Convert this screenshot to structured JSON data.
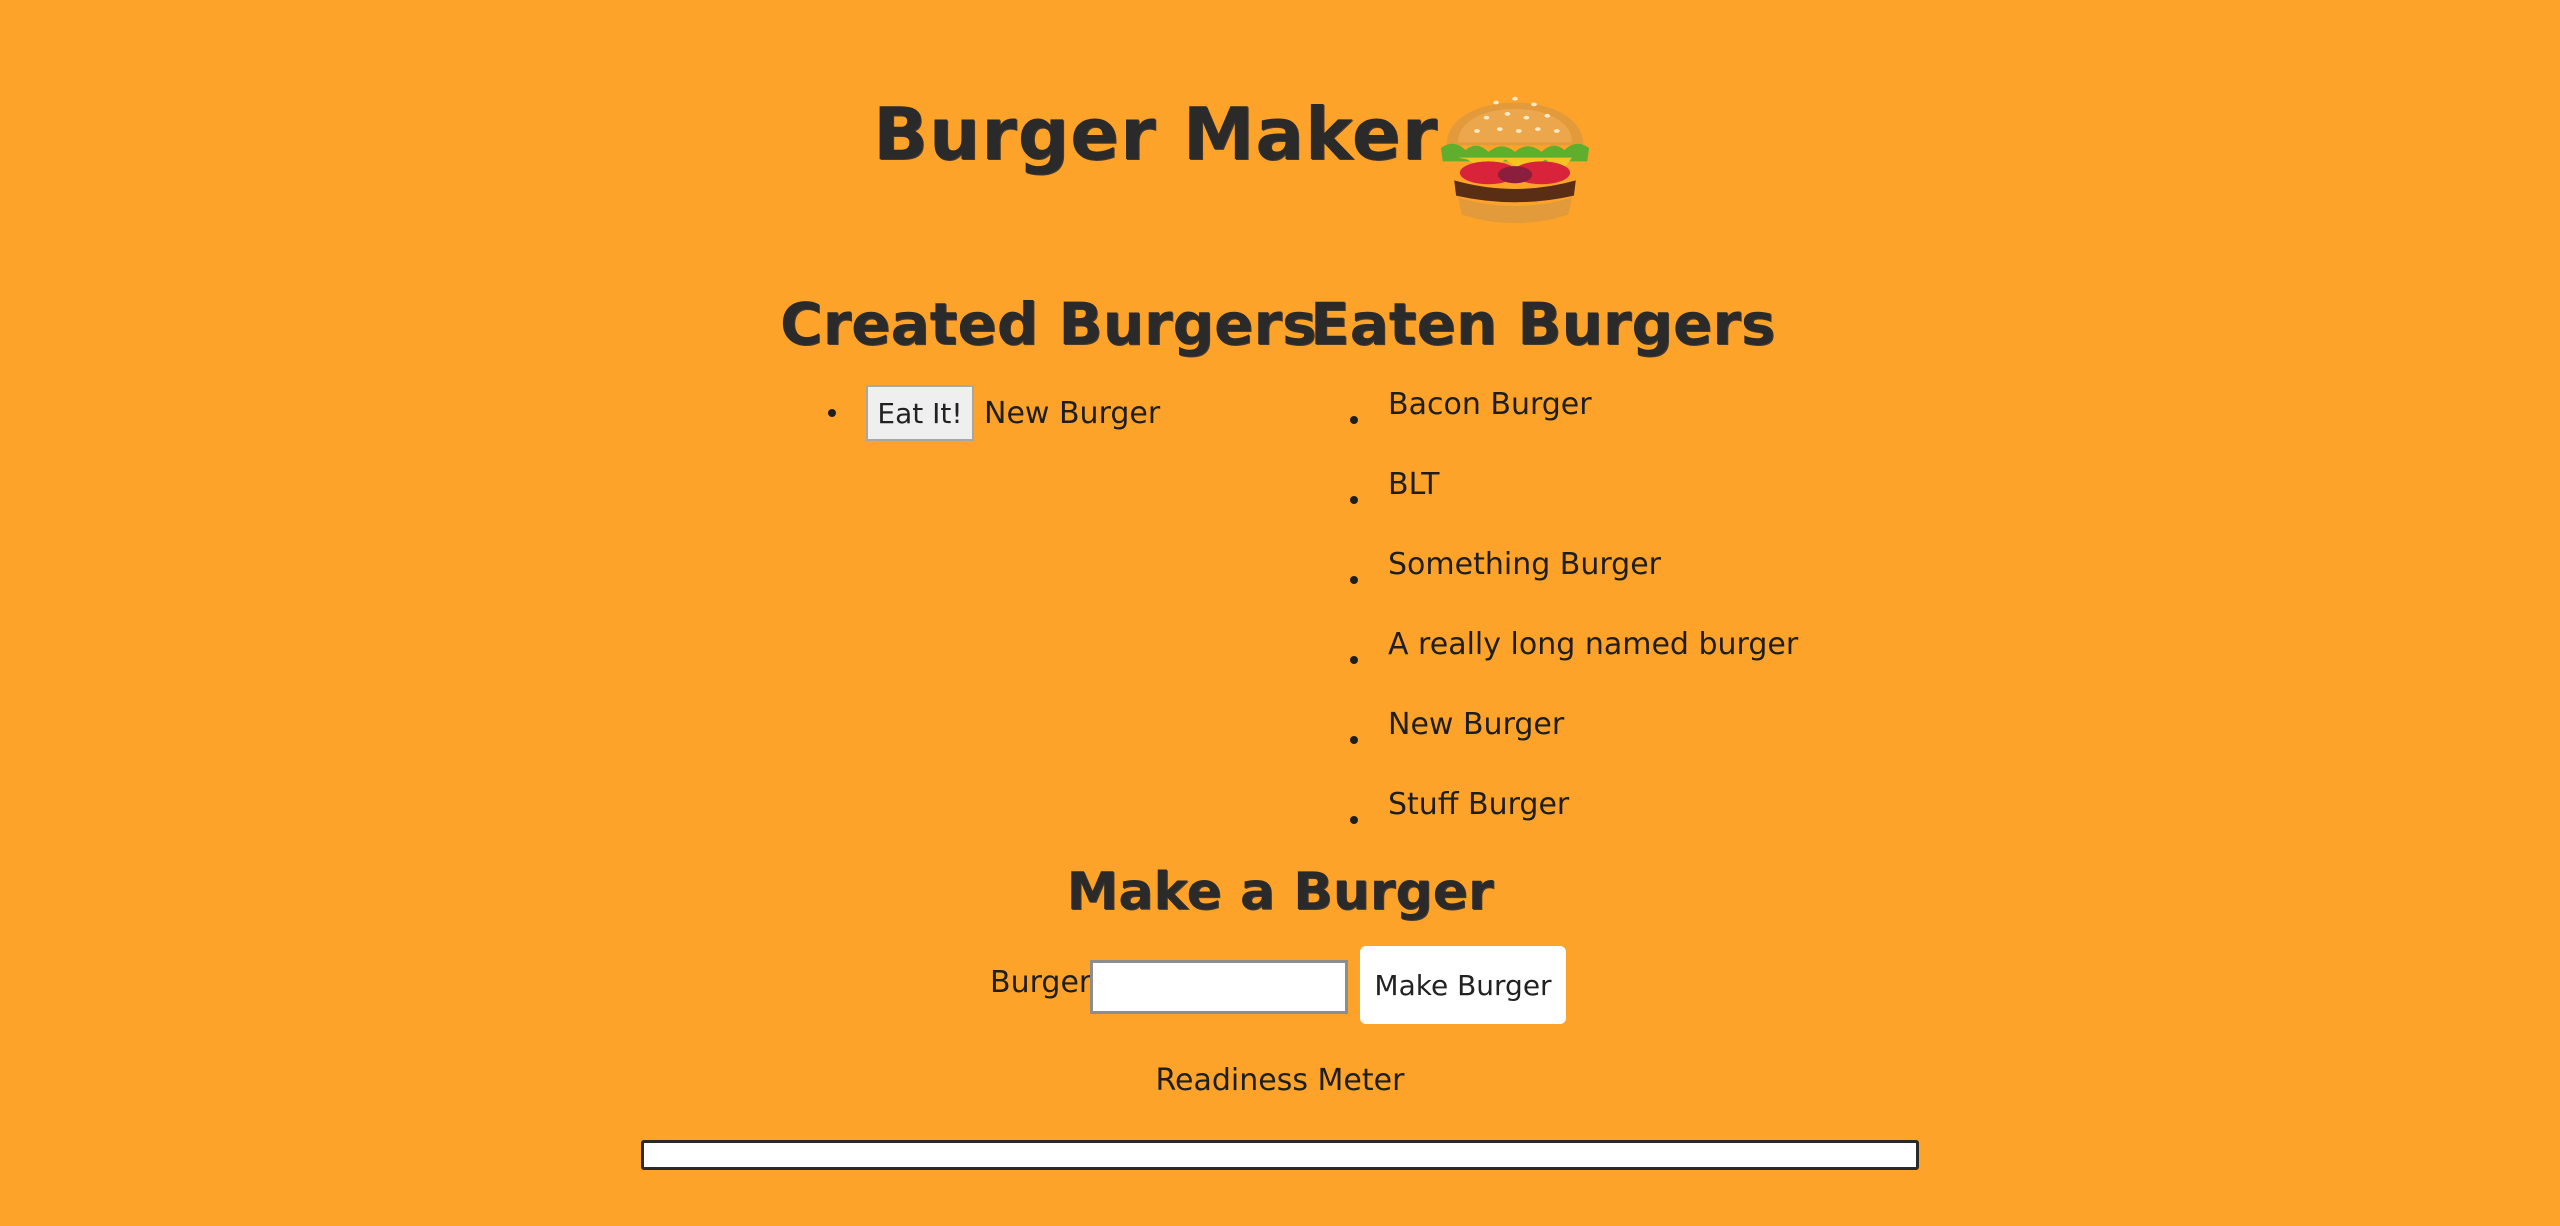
{
  "header": {
    "title": "Burger Maker"
  },
  "created": {
    "heading": "Created Burgers",
    "items": [
      {
        "button_label": "Eat It!",
        "name": "New Burger"
      }
    ]
  },
  "eaten": {
    "heading": "Eaten Burgers",
    "items": [
      "Bacon Burger",
      "BLT",
      "Something Burger",
      "A really long named burger",
      "New Burger",
      "Stuff Burger"
    ]
  },
  "make": {
    "heading": "Make a Burger",
    "field_label": "Burger:",
    "input_value": "",
    "button_label": "Make Burger"
  },
  "readiness": {
    "label": "Readiness Meter",
    "progress_percent": 0
  },
  "colors": {
    "background": "#fea329",
    "text": "#2a2a2a"
  },
  "icons": {
    "logo": "burger-icon"
  }
}
